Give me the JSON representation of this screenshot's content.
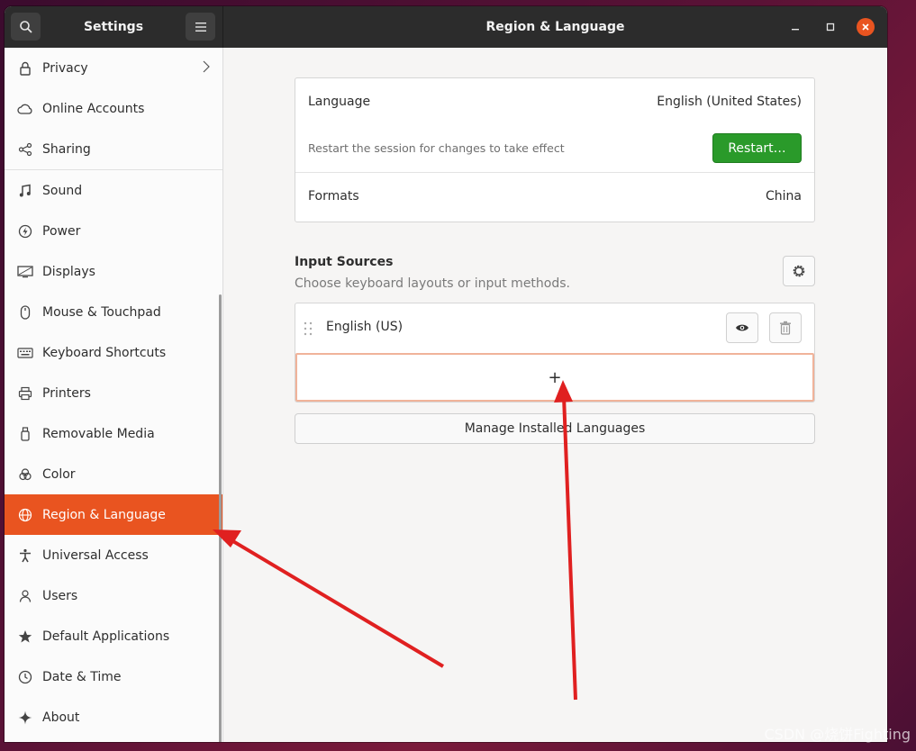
{
  "header": {
    "settings_title": "Settings",
    "panel_title": "Region & Language"
  },
  "sidebar": {
    "items": [
      {
        "label": "Privacy",
        "icon": "lock-icon"
      },
      {
        "label": "Online Accounts",
        "icon": "cloud-icon"
      },
      {
        "label": "Sharing",
        "icon": "share-icon"
      },
      {
        "label": "Sound",
        "icon": "music-note-icon"
      },
      {
        "label": "Power",
        "icon": "power-icon"
      },
      {
        "label": "Displays",
        "icon": "display-icon"
      },
      {
        "label": "Mouse & Touchpad",
        "icon": "mouse-icon"
      },
      {
        "label": "Keyboard Shortcuts",
        "icon": "keyboard-icon"
      },
      {
        "label": "Printers",
        "icon": "printer-icon"
      },
      {
        "label": "Removable Media",
        "icon": "usb-drive-icon"
      },
      {
        "label": "Color",
        "icon": "color-icon"
      },
      {
        "label": "Region & Language",
        "icon": "globe-icon",
        "active": true
      },
      {
        "label": "Universal Access",
        "icon": "accessibility-icon"
      },
      {
        "label": "Users",
        "icon": "users-icon"
      },
      {
        "label": "Default Applications",
        "icon": "star-icon"
      },
      {
        "label": "Date & Time",
        "icon": "clock-icon"
      },
      {
        "label": "About",
        "icon": "sparkle-icon"
      }
    ]
  },
  "main": {
    "language_label": "Language",
    "language_value": "English (United States)",
    "restart_note": "Restart the session for changes to take effect",
    "restart_button": "Restart…",
    "formats_label": "Formats",
    "formats_value": "China",
    "input_sources_title": "Input Sources",
    "input_sources_subtitle": "Choose keyboard layouts or input methods.",
    "input_source_item": "English (US)",
    "add_symbol": "+",
    "manage_button": "Manage Installed Languages"
  },
  "watermark": "CSDN @烧饼Fighting",
  "colors": {
    "accent": "#e95420",
    "restart_green": "#2a9a2a",
    "arrow_red": "#e02020"
  }
}
